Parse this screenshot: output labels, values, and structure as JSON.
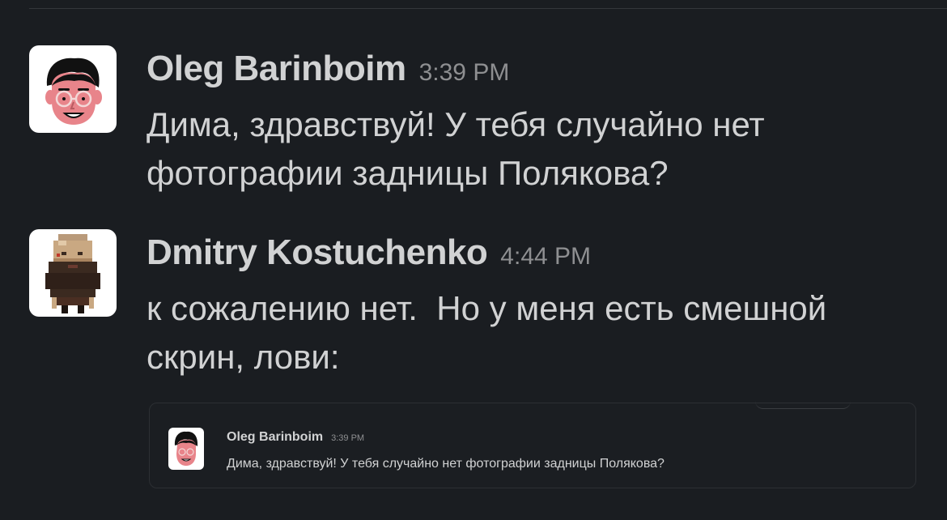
{
  "messages": [
    {
      "sender": "Oleg Barinboim",
      "time": "3:39 PM",
      "text": "Дима, здравствуй! У тебя случайно нет фотографии задницы Полякова?",
      "avatar_icon": "cartoon-man-glasses-avatar"
    },
    {
      "sender": "Dmitry Kostuchenko",
      "time": "4:44 PM",
      "text": "к сожалению нет.  Но у меня есть смешной скрин, лови:",
      "avatar_icon": "pixel-art-bearded-man-avatar"
    }
  ],
  "attachment": {
    "sender": "Oleg Barinboim",
    "time": "3:39 PM",
    "text": "Дима, здравствуй! У тебя случайно нет фотографии задницы Полякова?",
    "avatar_icon": "cartoon-man-glasses-avatar"
  },
  "colors": {
    "background": "#1a1d21",
    "text": "#d1d2d3",
    "timestamp": "#8e8f91",
    "avatar_face": "#e8848a",
    "pixel_beard": "#3b2a20"
  }
}
